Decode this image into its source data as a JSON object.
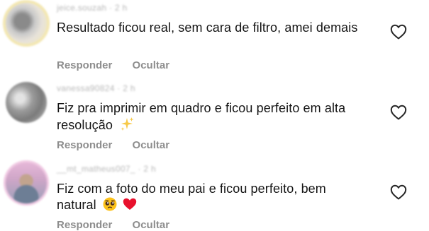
{
  "comments": [
    {
      "username": "jeice.souzah · 2 h",
      "text": "Resultado ficou real, sem cara de filtro, amei demais",
      "actions": {
        "reply": "Responder",
        "hide": "Ocultar"
      }
    },
    {
      "username": "vanessa90824 · 2 h",
      "text": "Fiz pra imprimir em quadro e ficou perfeito em alta resolução",
      "emoji": "sparkles-emoji",
      "actions": {
        "reply": "Responder",
        "hide": "Ocultar"
      }
    },
    {
      "username": "__mt_matheus007_ · 2 h",
      "text": "Fiz com a foto do meu pai e ficou perfeito, bem natural",
      "emoji": [
        "pleading-face-emoji",
        "red-heart-emoji"
      ],
      "actions": {
        "reply": "Responder",
        "hide": "Ocultar"
      }
    }
  ],
  "icons": {
    "like": "heart-outline-icon"
  },
  "colors": {
    "text": "#141414",
    "secondary": "#8e8e8e",
    "background": "#ffffff"
  }
}
